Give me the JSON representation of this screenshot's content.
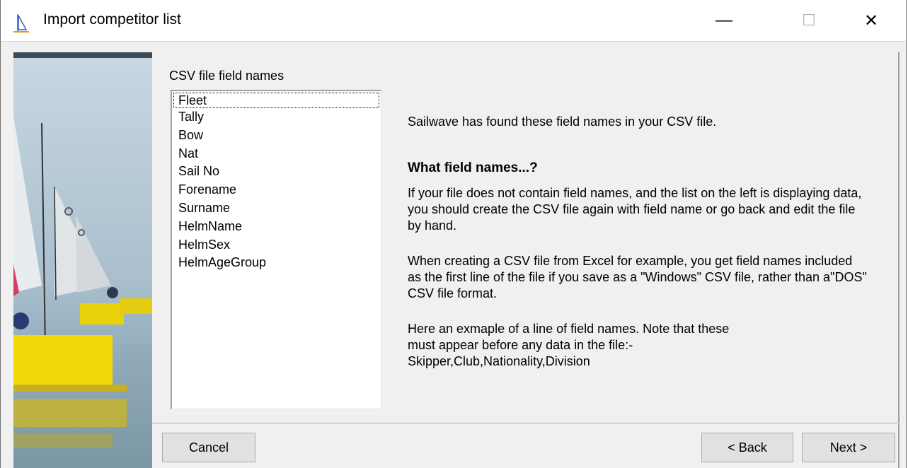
{
  "window": {
    "title": "Import competitor list",
    "controls": {
      "minimize": "—",
      "maximize": "☐",
      "close": "✕"
    }
  },
  "field_list": {
    "label": "CSV file field names",
    "items": [
      "Fleet",
      "Tally",
      "Bow",
      "Nat",
      "Sail No",
      "Forename",
      "Surname",
      "HelmName",
      "HelmSex",
      "HelmAgeGroup"
    ],
    "focused_index": 0
  },
  "help": {
    "intro": "Sailwave has found these field names in your CSV file.",
    "heading": "What field names...?",
    "para1": "If your file does not contain field names, and the list on the left is displaying data, you should create the CSV file again with field name or go back and edit the file by hand.",
    "para2": "When creating a CSV file from Excel for example, you get field names included as the first line of the file if you save as a \"Windows\" CSV file, rather than a\"DOS\" CSV file format.",
    "para3_line1": "Here an exmaple of a line of field names.  Note that these",
    "para3_line2": "must appear before any data in the file:-",
    "para3_line3": "Skipper,Club,Nationality,Division"
  },
  "buttons": {
    "cancel": "Cancel",
    "back": "< Back",
    "next": "Next >"
  },
  "colors": {
    "window_bg": "#f0f0f0",
    "titlebar_bg": "#ffffff",
    "button_bg": "#e1e1e1"
  }
}
